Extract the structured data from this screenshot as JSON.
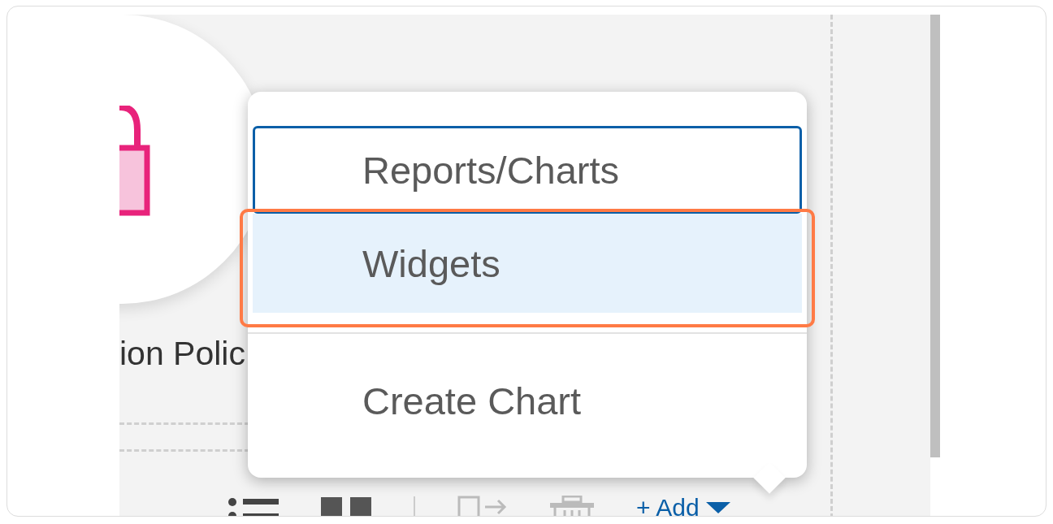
{
  "canvas": {
    "card_label": "ion Polic"
  },
  "menu": {
    "sections": [
      {
        "items": [
          {
            "label": "Reports/Charts",
            "selected": false,
            "focused": true,
            "annotated": false
          },
          {
            "label": "Widgets",
            "selected": true,
            "focused": false,
            "annotated": true
          }
        ]
      },
      {
        "items": [
          {
            "label": "Create Chart",
            "selected": false,
            "focused": false,
            "annotated": false
          }
        ]
      }
    ]
  },
  "toolbar": {
    "tools": [
      {
        "kind": "list"
      },
      {
        "kind": "columns"
      },
      {
        "kind": "separator"
      },
      {
        "kind": "move"
      },
      {
        "kind": "delete"
      }
    ],
    "add_button": {
      "label": "+ Add"
    }
  }
}
